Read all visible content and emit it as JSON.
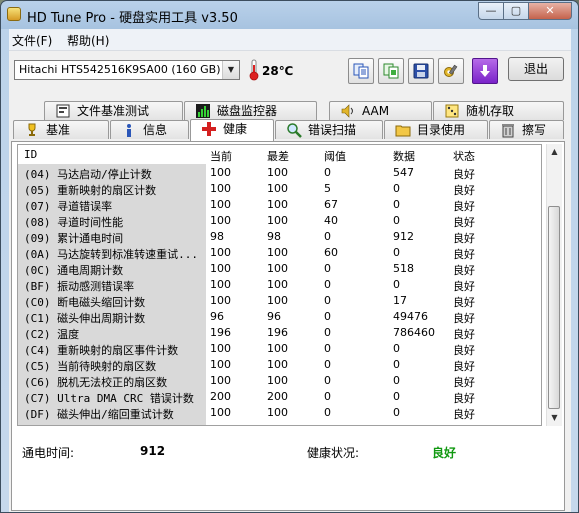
{
  "window": {
    "title": "HD Tune Pro - 硬盘实用工具 v3.50",
    "controls": {
      "minimize": "—",
      "maximize": "▢",
      "close": "✕"
    }
  },
  "menu": {
    "items": [
      "文件(F)",
      "帮助(H)"
    ]
  },
  "toolbar": {
    "drive": "Hitachi HTS542516K9SA00 (160 GB)",
    "temperature": "28℃",
    "buttons": [
      "copy-info",
      "copy-screenshot",
      "save",
      "options",
      "download"
    ],
    "exit_label": "退出"
  },
  "tabs": {
    "top": [
      {
        "label": "文件基准测试",
        "icon": "file-benchmark-icon"
      },
      {
        "label": "磁盘监控器",
        "icon": "disk-monitor-icon"
      },
      {
        "label": "AAM",
        "icon": "speaker-icon"
      },
      {
        "label": "随机存取",
        "icon": "random-access-icon"
      }
    ],
    "bottom": [
      {
        "label": "基准",
        "icon": "benchmark-icon"
      },
      {
        "label": "信息",
        "icon": "info-icon"
      },
      {
        "label": "健康",
        "icon": "health-icon",
        "active": true
      },
      {
        "label": "错误扫描",
        "icon": "magnifier-icon"
      },
      {
        "label": "目录使用",
        "icon": "folder-icon"
      },
      {
        "label": "擦写",
        "icon": "trash-icon"
      }
    ]
  },
  "smart": {
    "columns": [
      "ID",
      "当前",
      "最差",
      "阈值",
      "数据",
      "状态"
    ],
    "rows": [
      [
        "(04) 马达启动/停止计数",
        "100",
        "100",
        "0",
        "547",
        "良好"
      ],
      [
        "(05) 重新映射的扇区计数",
        "100",
        "100",
        "5",
        "0",
        "良好"
      ],
      [
        "(07) 寻道错误率",
        "100",
        "100",
        "67",
        "0",
        "良好"
      ],
      [
        "(08) 寻道时间性能",
        "100",
        "100",
        "40",
        "0",
        "良好"
      ],
      [
        "(09) 累计通电时间",
        "98",
        "98",
        "0",
        "912",
        "良好"
      ],
      [
        "(0A) 马达旋转到标准转速重试...",
        "100",
        "100",
        "60",
        "0",
        "良好"
      ],
      [
        "(0C) 通电周期计数",
        "100",
        "100",
        "0",
        "518",
        "良好"
      ],
      [
        "(BF) 振动感测错误率",
        "100",
        "100",
        "0",
        "0",
        "良好"
      ],
      [
        "(C0) 断电磁头缩回计数",
        "100",
        "100",
        "0",
        "17",
        "良好"
      ],
      [
        "(C1) 磁头伸出周期计数",
        "96",
        "96",
        "0",
        "49476",
        "良好"
      ],
      [
        "(C2) 温度",
        "196",
        "196",
        "0",
        "786460",
        "良好"
      ],
      [
        "(C4) 重新映射的扇区事件计数",
        "100",
        "100",
        "0",
        "0",
        "良好"
      ],
      [
        "(C5) 当前待映射的扇区数",
        "100",
        "100",
        "0",
        "0",
        "良好"
      ],
      [
        "(C6) 脱机无法校正的扇区数",
        "100",
        "100",
        "0",
        "0",
        "良好"
      ],
      [
        "(C7) Ultra DMA CRC 错误计数",
        "200",
        "200",
        "0",
        "0",
        "良好"
      ],
      [
        "(DF) 磁头伸出/缩回重试计数",
        "100",
        "100",
        "0",
        "0",
        "良好"
      ]
    ]
  },
  "footer": {
    "power_on_label": "通电时间:",
    "power_on_value": "912",
    "health_label": "健康状况:",
    "health_value": "良好"
  },
  "colors": {
    "good": "#119911",
    "accent_download": "#8a2be2"
  }
}
